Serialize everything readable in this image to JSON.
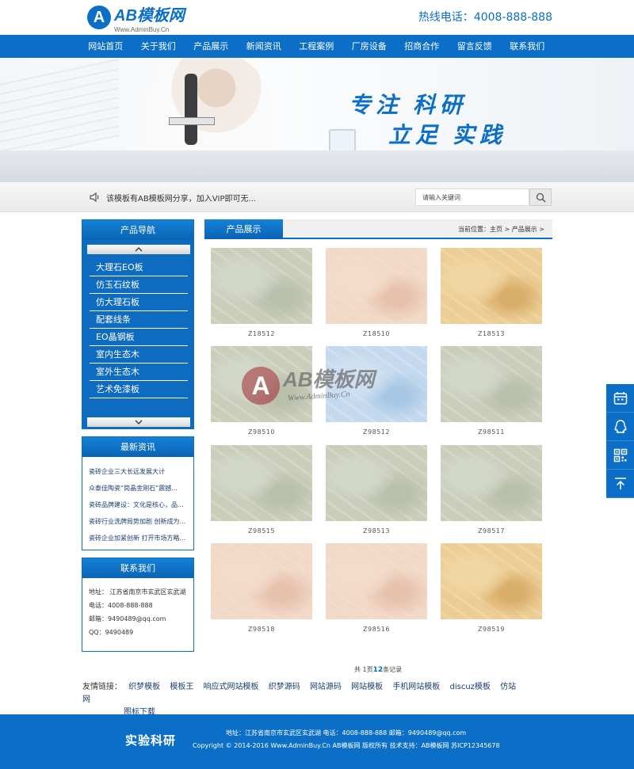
{
  "header": {
    "logo_mark": "A",
    "logo_title": "AB模板网",
    "logo_sub": "Www.AdminBuy.Cn",
    "hotline_label": "热线电话：",
    "hotline_number": "4008-888-888"
  },
  "nav": [
    "网站首页",
    "关于我们",
    "产品展示",
    "新闻资讯",
    "工程案例",
    "厂房设备",
    "招商合作",
    "留言反馈",
    "联系我们"
  ],
  "banner": {
    "slogan_line1": "专注 科研",
    "slogan_line2": "立足 实践"
  },
  "notice": {
    "message": "该模板有AB模板网分享，加入VIP即可无...",
    "search_placeholder": "请输入关键词"
  },
  "sidebar": {
    "product_nav_title": "产品导航",
    "product_categories": [
      "大理石EO板",
      "仿玉石纹板",
      "仿大理石板",
      "配套线条",
      "EO晶钢板",
      "室内生态木",
      "室外生态木",
      "艺术免漆板"
    ],
    "news_title": "最新资讯",
    "news": [
      "瓷砖企业三大长远发展大计",
      "众泰佳陶瓷“岗晶金刚石”震撼...",
      "瓷砖品牌建设：文化是核心，品...",
      "瓷砖行业洗牌局势加剧 创新成为...",
      "瓷砖企业加紧创新 打开市场方略..."
    ],
    "contact_title": "联系我们",
    "contact": {
      "address": "地址： 江苏省南京市玄武区玄武湖",
      "phone": "电话：4008-888-888",
      "email": "邮箱：9490489@qq.com",
      "qq": "QQ：9490489"
    }
  },
  "main": {
    "tab_title": "产品展示",
    "breadcrumb": "当前位置：主页 > 产品展示 >",
    "products": [
      {
        "code": "Z18512",
        "tone": "grey-green"
      },
      {
        "code": "Z18510",
        "tone": "peach"
      },
      {
        "code": "Z18513",
        "tone": "gold"
      },
      {
        "code": "Z98510",
        "tone": "grey-green"
      },
      {
        "code": "Z98512",
        "tone": "blue"
      },
      {
        "code": "Z98511",
        "tone": "grey-green"
      },
      {
        "code": "Z98515",
        "tone": "grey-green"
      },
      {
        "code": "Z98513",
        "tone": "grey-green"
      },
      {
        "code": "Z98517",
        "tone": "grey-green"
      },
      {
        "code": "Z98518",
        "tone": "peach"
      },
      {
        "code": "Z98516",
        "tone": "peach"
      },
      {
        "code": "Z98519",
        "tone": "gold"
      }
    ],
    "watermark_mark": "A",
    "watermark_title": "AB模板网",
    "watermark_sub": "Www.AdminBuy.Cn",
    "pager_prefix": "共 1页",
    "pager_count": "12",
    "pager_suffix": "条记录"
  },
  "links": {
    "label": "友情链接：",
    "items": [
      "织梦模板",
      "模板王",
      "响应式网站模板",
      "织梦源码",
      "网站源码",
      "网站模板",
      "手机网站模板",
      "discuz模板",
      "仿站网",
      "图标下载"
    ]
  },
  "footer": {
    "brand": "实验科研",
    "line1": "地址：江苏省南京市玄武区玄武湖   电话：4008-888-888   邮箱：9490489@qq.com",
    "line2": "Copyright © 2014-2016 Www.AdminBuy.Cn AB模板网 版权所有   技术支持：AB模板网   苏ICP12345678"
  },
  "side_tools": [
    "calendar-icon",
    "qq-icon",
    "qrcode-icon",
    "back-to-top-icon"
  ],
  "colors": {
    "brand_blue": "#0b6fc7",
    "grey-green": "#c8cdbb",
    "peach": "#efd2bf",
    "gold": "#e6c389",
    "blue": "#b7d1ea"
  }
}
